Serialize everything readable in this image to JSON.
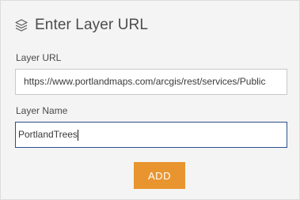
{
  "panel": {
    "title": "Enter Layer URL",
    "header_icon": "layers-icon"
  },
  "fields": {
    "url_label": "Layer URL",
    "url_value": "https://www.portlandmaps.com/arcgis/rest/services/Public",
    "name_label": "Layer Name",
    "name_value": "PortlandTrees"
  },
  "actions": {
    "add_label": "ADD"
  },
  "colors": {
    "accent": "#e8952f",
    "focus_border": "#2f4f8f",
    "background": "#f4f4f4"
  }
}
